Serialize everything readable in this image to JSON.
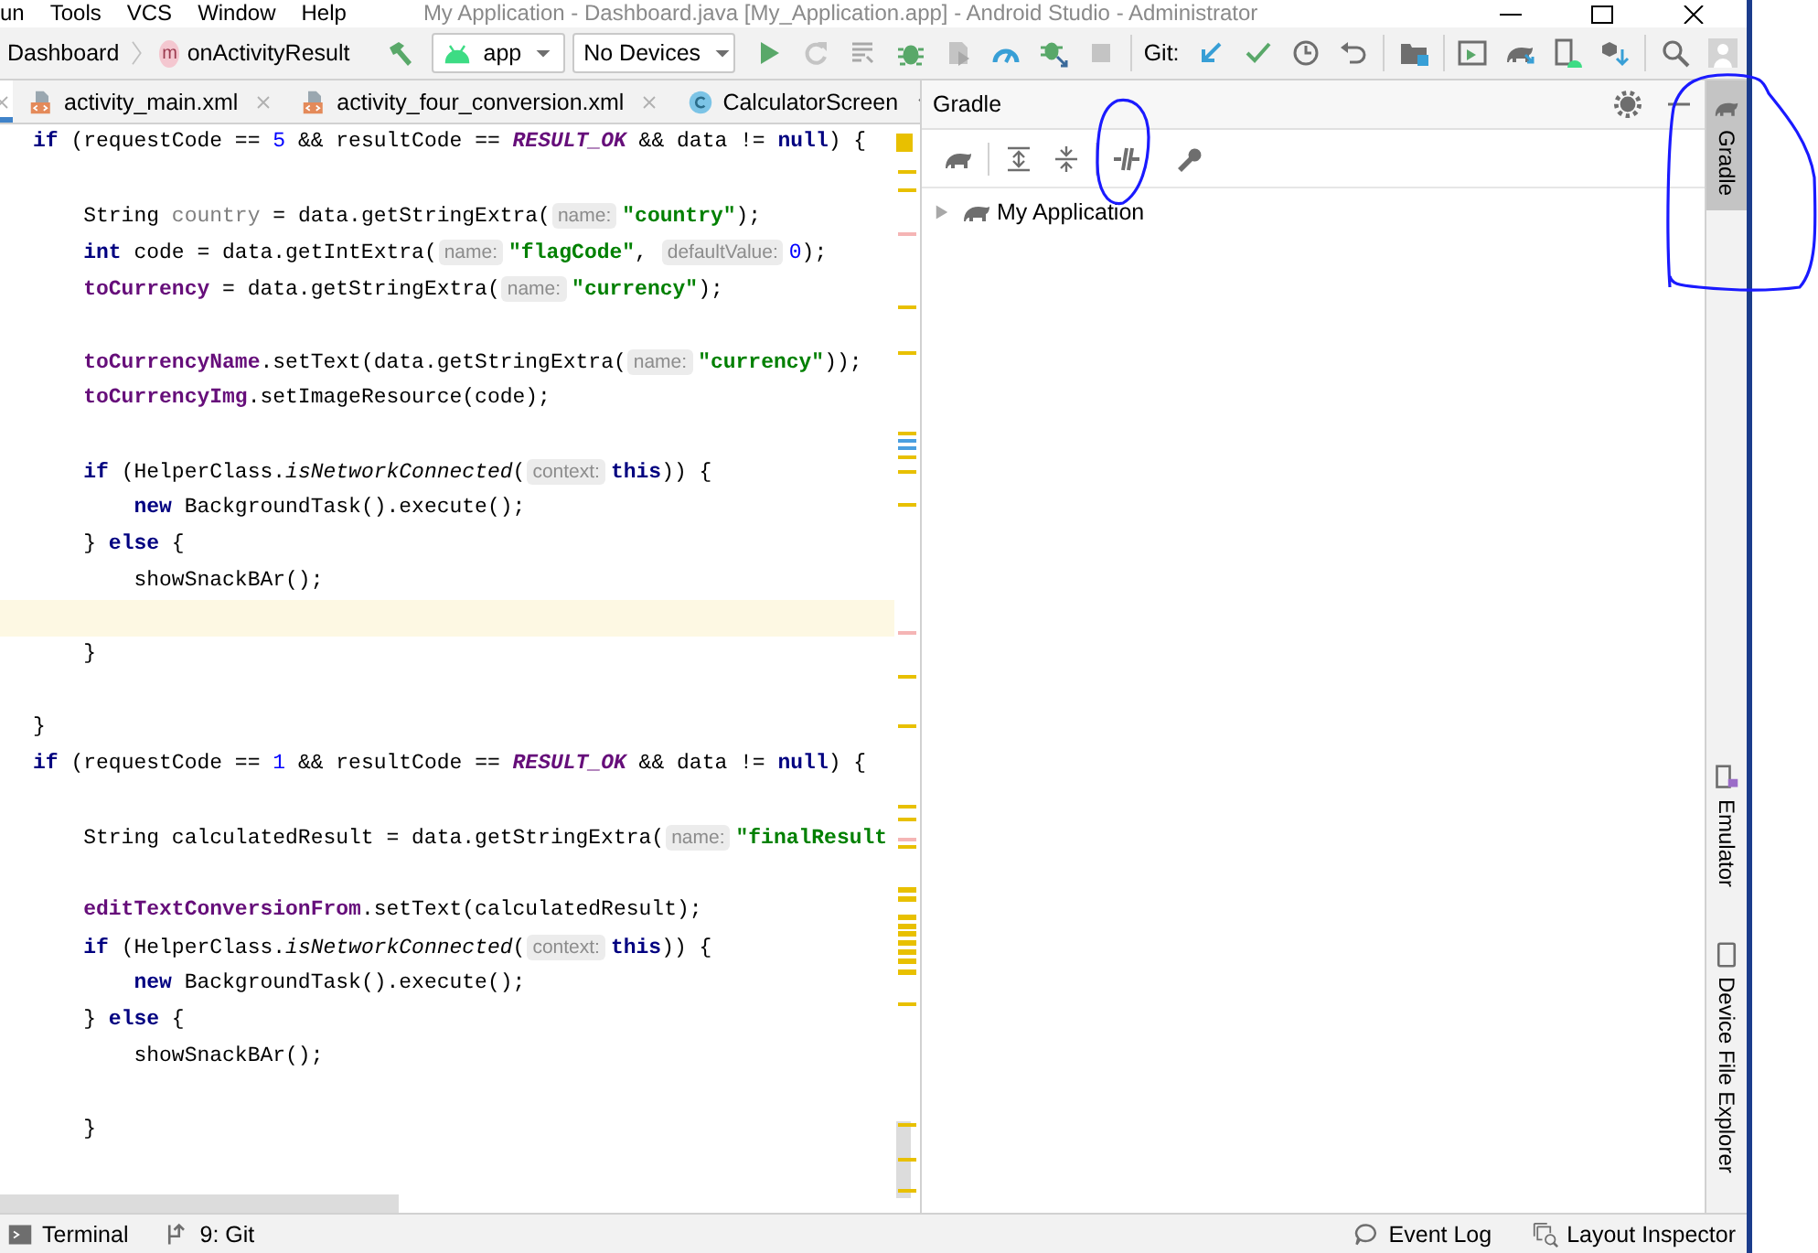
{
  "window": {
    "title": "My Application - Dashboard.java [My_Application.app] - Android Studio - Administrator",
    "menu": [
      "un",
      "Tools",
      "VCS",
      "Window",
      "Help"
    ]
  },
  "toolbar": {
    "breadcrumbs": [
      {
        "label": "Dashboard"
      },
      {
        "badge": "m",
        "label": "onActivityResult"
      }
    ],
    "run_config": "app",
    "device": "No Devices",
    "vcs_label": "Git:"
  },
  "editor_tabs": [
    {
      "selected": true
    },
    {
      "label": "activity_main.xml",
      "kind": "xml",
      "selected": false
    },
    {
      "label": "activity_four_conversion.xml",
      "kind": "xml",
      "selected": false
    },
    {
      "label": "CalculatorScreen",
      "kind": "class",
      "selected": false
    }
  ],
  "code_lines": [
    {
      "kind": "code",
      "current": false,
      "tokens": [
        {
          "text": "if",
          "kind": "keyword"
        },
        {
          "text": " (requestCode == ",
          "kind": "plain"
        },
        {
          "text": "5",
          "kind": "number"
        },
        {
          "text": " && resultCode == ",
          "kind": "plain"
        },
        {
          "text": "RESULT_OK",
          "kind": "constant"
        },
        {
          "text": " && data != ",
          "kind": "plain"
        },
        {
          "text": "null",
          "kind": "keyword"
        },
        {
          "text": ") {",
          "kind": "plain"
        }
      ]
    },
    {
      "kind": "blank",
      "current": false
    },
    {
      "kind": "code",
      "current": false,
      "tokens": [
        {
          "text": "    String ",
          "kind": "plain"
        },
        {
          "text": "country",
          "kind": "unused"
        },
        {
          "text": " = data.getStringExtra(",
          "kind": "plain"
        },
        {
          "text": "name:",
          "kind": "hint"
        },
        {
          "text": "\"country\"",
          "kind": "string"
        },
        {
          "text": ");",
          "kind": "plain"
        }
      ]
    },
    {
      "kind": "code",
      "current": false,
      "tokens": [
        {
          "text": "    int",
          "kind": "keyword"
        },
        {
          "text": " code = data.getIntExtra(",
          "kind": "plain"
        },
        {
          "text": "name:",
          "kind": "hint"
        },
        {
          "text": "\"flagCode\"",
          "kind": "string"
        },
        {
          "text": ", ",
          "kind": "plain"
        },
        {
          "text": "defaultValue:",
          "kind": "hint"
        },
        {
          "text": "0",
          "kind": "number"
        },
        {
          "text": ");",
          "kind": "plain"
        }
      ]
    },
    {
      "kind": "code",
      "current": false,
      "tokens": [
        {
          "text": "    toCurrency",
          "kind": "field"
        },
        {
          "text": " = data.getStringExtra(",
          "kind": "plain"
        },
        {
          "text": "name:",
          "kind": "hint"
        },
        {
          "text": "\"currency\"",
          "kind": "string"
        },
        {
          "text": ");",
          "kind": "plain"
        }
      ]
    },
    {
      "kind": "blank",
      "current": false
    },
    {
      "kind": "code",
      "current": false,
      "tokens": [
        {
          "text": "    toCurrencyName",
          "kind": "field"
        },
        {
          "text": ".setText(data.getStringExtra(",
          "kind": "plain"
        },
        {
          "text": "name:",
          "kind": "hint"
        },
        {
          "text": "\"currency\"",
          "kind": "string"
        },
        {
          "text": "));",
          "kind": "plain"
        }
      ]
    },
    {
      "kind": "code",
      "current": false,
      "tokens": [
        {
          "text": "    toCurrencyImg",
          "kind": "field"
        },
        {
          "text": ".setImageResource(code);",
          "kind": "plain"
        }
      ]
    },
    {
      "kind": "blank",
      "current": false
    },
    {
      "kind": "code",
      "current": false,
      "tokens": [
        {
          "text": "    if",
          "kind": "keyword"
        },
        {
          "text": " (HelperClass.",
          "kind": "plain"
        },
        {
          "text": "isNetworkConnected",
          "kind": "static"
        },
        {
          "text": "(",
          "kind": "plain"
        },
        {
          "text": "context:",
          "kind": "hint"
        },
        {
          "text": "this",
          "kind": "keyword"
        },
        {
          "text": ")) {",
          "kind": "plain"
        }
      ]
    },
    {
      "kind": "code",
      "current": false,
      "tokens": [
        {
          "text": "        new",
          "kind": "keyword"
        },
        {
          "text": " BackgroundTask().execute();",
          "kind": "plain"
        }
      ]
    },
    {
      "kind": "code",
      "current": false,
      "tokens": [
        {
          "text": "    } ",
          "kind": "plain"
        },
        {
          "text": "else",
          "kind": "keyword"
        },
        {
          "text": " {",
          "kind": "plain"
        }
      ]
    },
    {
      "kind": "code",
      "current": false,
      "tokens": [
        {
          "text": "        showSnackBAr();",
          "kind": "plain"
        }
      ]
    },
    {
      "kind": "blank",
      "current": true
    },
    {
      "kind": "code",
      "current": false,
      "tokens": [
        {
          "text": "    }",
          "kind": "plain"
        }
      ]
    },
    {
      "kind": "blank",
      "current": false
    },
    {
      "kind": "code",
      "current": false,
      "tokens": [
        {
          "text": "}",
          "kind": "plain"
        }
      ]
    },
    {
      "kind": "code",
      "current": false,
      "tokens": [
        {
          "text": "if",
          "kind": "keyword"
        },
        {
          "text": " (requestCode == ",
          "kind": "plain"
        },
        {
          "text": "1",
          "kind": "number"
        },
        {
          "text": " && resultCode == ",
          "kind": "plain"
        },
        {
          "text": "RESULT_OK",
          "kind": "constant"
        },
        {
          "text": " && data != ",
          "kind": "plain"
        },
        {
          "text": "null",
          "kind": "keyword"
        },
        {
          "text": ") {",
          "kind": "plain"
        }
      ]
    },
    {
      "kind": "blank",
      "current": false
    },
    {
      "kind": "code",
      "current": false,
      "tokens": [
        {
          "text": "    String calculatedResult = data.getStringExtra(",
          "kind": "plain"
        },
        {
          "text": "name:",
          "kind": "hint"
        },
        {
          "text": "\"finalResult",
          "kind": "string"
        }
      ]
    },
    {
      "kind": "blank",
      "current": false
    },
    {
      "kind": "code",
      "current": false,
      "tokens": [
        {
          "text": "    editTextConversionFrom",
          "kind": "field"
        },
        {
          "text": ".setText(calculatedResult);",
          "kind": "plain"
        }
      ]
    },
    {
      "kind": "code",
      "current": false,
      "tokens": [
        {
          "text": "    if",
          "kind": "keyword"
        },
        {
          "text": " (HelperClass.",
          "kind": "plain"
        },
        {
          "text": "isNetworkConnected",
          "kind": "static"
        },
        {
          "text": "(",
          "kind": "plain"
        },
        {
          "text": "context:",
          "kind": "hint"
        },
        {
          "text": "this",
          "kind": "keyword"
        },
        {
          "text": ")) {",
          "kind": "plain"
        }
      ]
    },
    {
      "kind": "code",
      "current": false,
      "tokens": [
        {
          "text": "        new",
          "kind": "keyword"
        },
        {
          "text": " BackgroundTask().execute();",
          "kind": "plain"
        }
      ]
    },
    {
      "kind": "code",
      "current": false,
      "tokens": [
        {
          "text": "    } ",
          "kind": "plain"
        },
        {
          "text": "else",
          "kind": "keyword"
        },
        {
          "text": " {",
          "kind": "plain"
        }
      ]
    },
    {
      "kind": "code",
      "current": false,
      "tokens": [
        {
          "text": "        showSnackBAr();",
          "kind": "plain"
        }
      ]
    },
    {
      "kind": "blank",
      "current": false
    },
    {
      "kind": "code",
      "current": false,
      "tokens": [
        {
          "text": "    }",
          "kind": "plain"
        }
      ]
    }
  ],
  "gradle_panel": {
    "title": "Gradle",
    "tree": [
      {
        "label": "My Application",
        "expanded": false
      }
    ]
  },
  "tool_strip": [
    {
      "label": "Gradle",
      "kind": "gradle",
      "docked_bottom": false,
      "selected": true
    },
    {
      "label": "Emulator",
      "kind": "emulator",
      "docked_bottom": true,
      "selected": false
    },
    {
      "label": "Device File Explorer",
      "kind": "device",
      "docked_bottom": true,
      "selected": false
    }
  ],
  "status_bar": {
    "left": [
      {
        "label": "Terminal",
        "kind": "terminal"
      },
      {
        "label": "9: Git",
        "kind": "vcs"
      }
    ],
    "right": [
      {
        "label": "Event Log",
        "kind": "log"
      },
      {
        "label": "Layout Inspector",
        "kind": "inspector"
      }
    ]
  }
}
